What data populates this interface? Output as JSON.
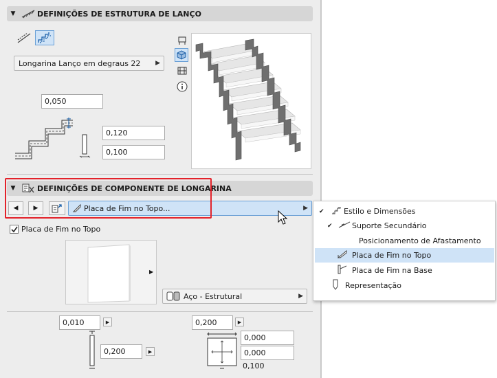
{
  "section1": {
    "title": "DEFINIÇÕES DE ESTRUTURA DE LANÇO",
    "stringer_type": "Longarina Lanço em degraus 22",
    "value_top": "0,050",
    "value_width": "0,120",
    "value_height": "0,100"
  },
  "section2": {
    "title": "DEFINIÇÕES DE COMPONENTE DE LONGARINA",
    "component_select": "Placa de Fim no Topo...",
    "checkbox_label": "Placa de Fim no Topo",
    "material": "Aço - Estrutural",
    "thickness": "0,010",
    "plate_height": "0,200",
    "plate_width": "0,200",
    "offset_x": "0,000",
    "offset_y": "0,000",
    "offset_total": "0,100"
  },
  "menu": {
    "items": [
      "Estilo e Dimensões",
      "Suporte Secundário",
      "Posicionamento de Afastamento",
      "Placa de Fim no Topo",
      "Placa de Fim na Base",
      "Representação"
    ]
  },
  "colors": {
    "highlight_box": "#e3222a",
    "selected_item": "#cfe3f7",
    "select_blue": "#cfe3f7"
  }
}
